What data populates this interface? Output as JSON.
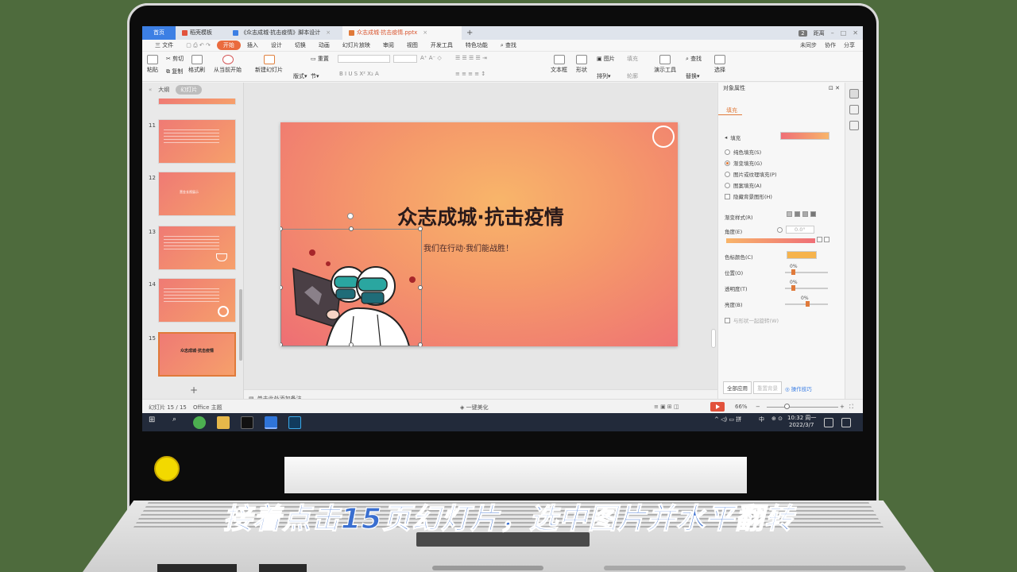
{
  "caption": "接着点击15页幻灯片，选中图片并水平翻转",
  "tabs": {
    "home": "首页",
    "template": "稻壳模板",
    "doc": "《众志成城·抗击疫情》脚本设计",
    "ppt": "众志成城·抗击疫情.pptx"
  },
  "tabbar_right": {
    "badge": "2",
    "user": "距离"
  },
  "menu": {
    "file": "三 文件",
    "items": [
      "开始",
      "插入",
      "设计",
      "切换",
      "动画",
      "幻灯片放映",
      "审阅",
      "视图",
      "开发工具",
      "特色功能"
    ],
    "search": "查找",
    "right": [
      "未同步",
      "协作",
      "分享"
    ]
  },
  "ribbon": {
    "paste": "粘贴",
    "cut": "剪切",
    "copy": "复制",
    "format_painter": "格式刷",
    "from_current": "从当前开始",
    "new_slide": "新建幻灯片",
    "layout": "版式",
    "section": "节",
    "reset": "重置",
    "textbox": "文本框",
    "shape": "形状",
    "arrange": "排列",
    "picture": "图片",
    "fill": "填充",
    "outline": "轮廓",
    "present_tools": "演示工具",
    "find": "查找",
    "replace": "替换",
    "select": "选择"
  },
  "left_panel": {
    "tab_outline": "大纲",
    "tab_slides": "幻灯片",
    "slides": [
      {
        "num": "11"
      },
      {
        "num": "12",
        "title": "营金长视展示"
      },
      {
        "num": "13"
      },
      {
        "num": "14"
      },
      {
        "num": "15",
        "title": "众志成城·抗击疫情"
      }
    ]
  },
  "slide": {
    "title": "众志成城·抗击疫情",
    "subtitle": "我们在行动·我们能战胜！"
  },
  "notes_placeholder": "单击此处添加备注",
  "right_panel": {
    "title": "对象属性",
    "fill_tab": "填充",
    "fill_label": "填充",
    "options": [
      "纯色填充(S)",
      "渐变填充(G)",
      "图片或纹理填充(P)",
      "图案填充(A)"
    ],
    "hide_bg": "隐藏背景图形(H)",
    "gradient_style": "渐变样式(R)",
    "angle": "角度(E)",
    "angle_value": "0.0°",
    "color_stop": "色标颜色(C)",
    "position": "位置(O)",
    "position_value": "0%",
    "transparency": "透明度(T)",
    "transparency_value": "0%",
    "brightness": "亮度(B)",
    "brightness_value": "0%",
    "rotate_with_shape": "与形状一起旋转(W)",
    "apply_all": "全部应用",
    "reset_bg": "重置背景",
    "tips": "操作技巧"
  },
  "status": {
    "slide_info": "幻灯片 15 / 15",
    "theme": "Office 主题",
    "beautify": "一键美化",
    "zoom": "66%"
  },
  "taskbar": {
    "time": "10:32 周一",
    "date": "2022/3/7",
    "ime": "中"
  },
  "colors": {
    "accent": "#ea6b3e",
    "tab_blue": "#3c7fe4",
    "fill_gradient_from": "#ef6f77",
    "fill_gradient_to": "#f8b56a"
  }
}
